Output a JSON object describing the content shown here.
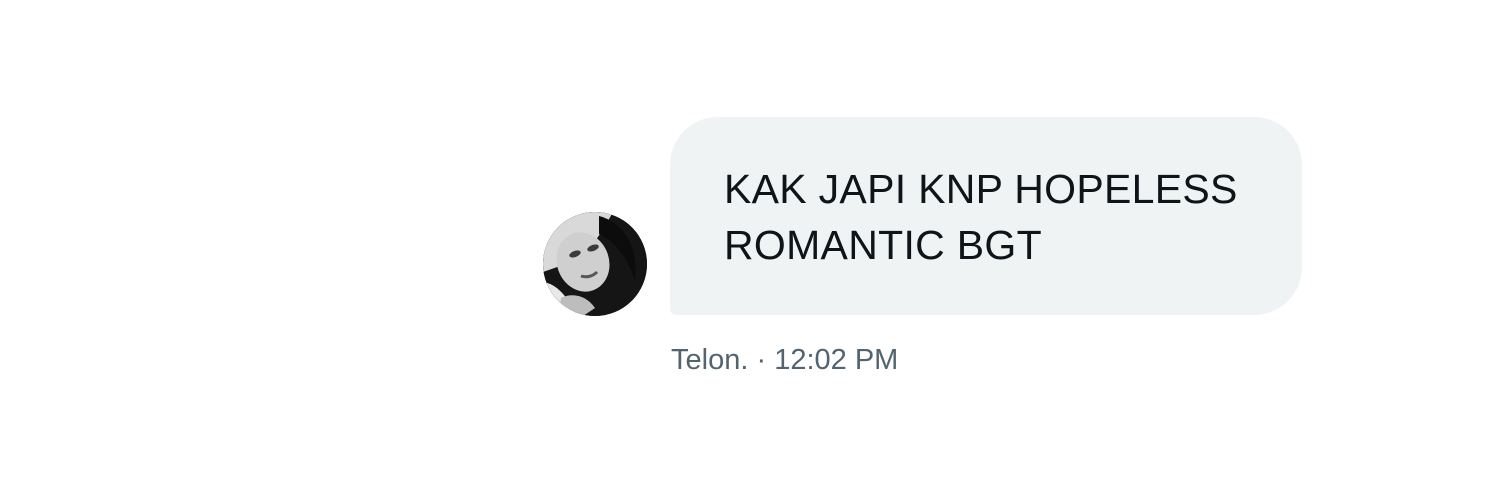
{
  "conversation": {
    "message": {
      "lines": [
        "KAK JAPI KNP HOPELESS",
        "ROMANTIC BGT"
      ],
      "sender": "Telon.",
      "separator": "·",
      "time": "12:02 PM"
    },
    "avatar": {
      "icon": "profile-photo-avatar"
    }
  },
  "colors": {
    "bubble_background": "#eff3f4",
    "message_text": "#0f1419",
    "meta_text": "#536471"
  }
}
